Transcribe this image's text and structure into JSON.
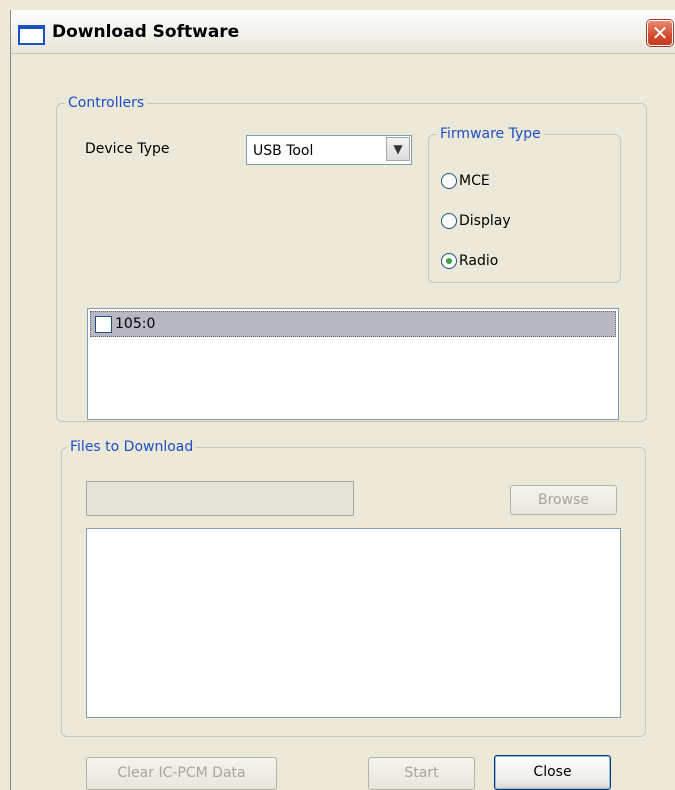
{
  "window": {
    "title": "Download Software"
  },
  "controllers": {
    "legend": "Controllers",
    "device_type_label": "Device Type",
    "device_type_value": "USB Tool",
    "firmware": {
      "legend": "Firmware Type",
      "options": [
        {
          "label": "MCE",
          "selected": false
        },
        {
          "label": "Display",
          "selected": false
        },
        {
          "label": "Radio",
          "selected": true
        }
      ]
    },
    "list_items": [
      {
        "label": "105:0",
        "checked": false,
        "highlighted": true
      }
    ]
  },
  "files": {
    "legend": "Files to Download",
    "path_value": "",
    "browse_label": "Browse"
  },
  "buttons": {
    "clear_label": "Clear IC-PCM Data",
    "start_label": "Start",
    "close_label": "Close"
  },
  "colors": {
    "legend_text": "#1f4fc7",
    "dialog_background": "#ece9d8",
    "close_button": "#d54c2f",
    "selected_row": "#b8b8c4"
  },
  "icons": {
    "window_icon": "window-icon",
    "close": "close-icon",
    "dropdown": "chevron-down-icon"
  }
}
